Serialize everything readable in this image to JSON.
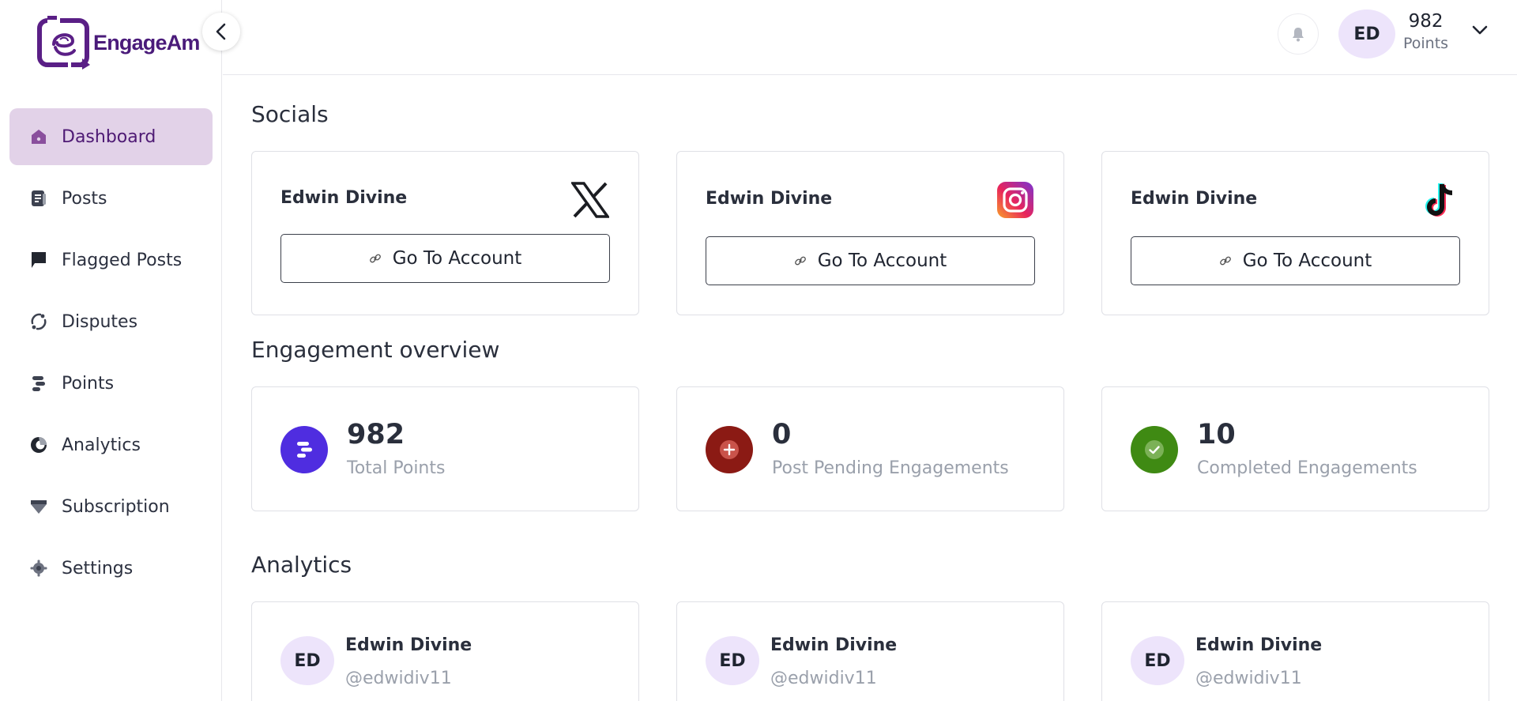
{
  "app": {
    "logo_text": "EngageAm"
  },
  "sidebar": {
    "items": [
      {
        "label": "Dashboard",
        "icon": "home-icon",
        "active": true
      },
      {
        "label": "Posts",
        "icon": "document-icon"
      },
      {
        "label": "Flagged Posts",
        "icon": "flag-icon"
      },
      {
        "label": "Disputes",
        "icon": "disputes-icon"
      },
      {
        "label": "Points",
        "icon": "points-icon"
      },
      {
        "label": "Analytics",
        "icon": "analytics-icon"
      },
      {
        "label": "Subscription",
        "icon": "diamond-icon"
      },
      {
        "label": "Settings",
        "icon": "gear-icon"
      }
    ]
  },
  "header": {
    "avatar_initials": "ED",
    "points_value": "982",
    "points_label": "Points"
  },
  "socials": {
    "title": "Socials",
    "cards": [
      {
        "name": "Edwin Divine",
        "platform_icon": "x-logo-icon",
        "button": "Go To Account"
      },
      {
        "name": "Edwin Divine",
        "platform_icon": "instagram-logo-icon",
        "button": "Go To Account"
      },
      {
        "name": "Edwin Divine",
        "platform_icon": "tiktok-logo-icon",
        "button": "Go To Account"
      }
    ]
  },
  "engagement": {
    "title": "Engagement overview",
    "cards": [
      {
        "value": "982",
        "label": "Total Points",
        "color": "#4f2de0",
        "icon": "points-icon"
      },
      {
        "value": "0",
        "label": "Post Pending Engagements",
        "color": "#8b1a14",
        "icon": "plus-icon"
      },
      {
        "value": "10",
        "label": "Completed Engagements",
        "color": "#3f8a13",
        "icon": "check-icon"
      }
    ]
  },
  "analytics": {
    "title": "Analytics",
    "cards": [
      {
        "initials": "ED",
        "name": "Edwin Divine",
        "handle": "@edwidiv11"
      },
      {
        "initials": "ED",
        "name": "Edwin Divine",
        "handle": "@edwidiv11"
      },
      {
        "initials": "ED",
        "name": "Edwin Divine",
        "handle": "@edwidiv11"
      }
    ]
  },
  "colors": {
    "accent": "#4e1a74",
    "active_bg": "#e2d2e8",
    "avatar_bg": "#ede4fb"
  }
}
